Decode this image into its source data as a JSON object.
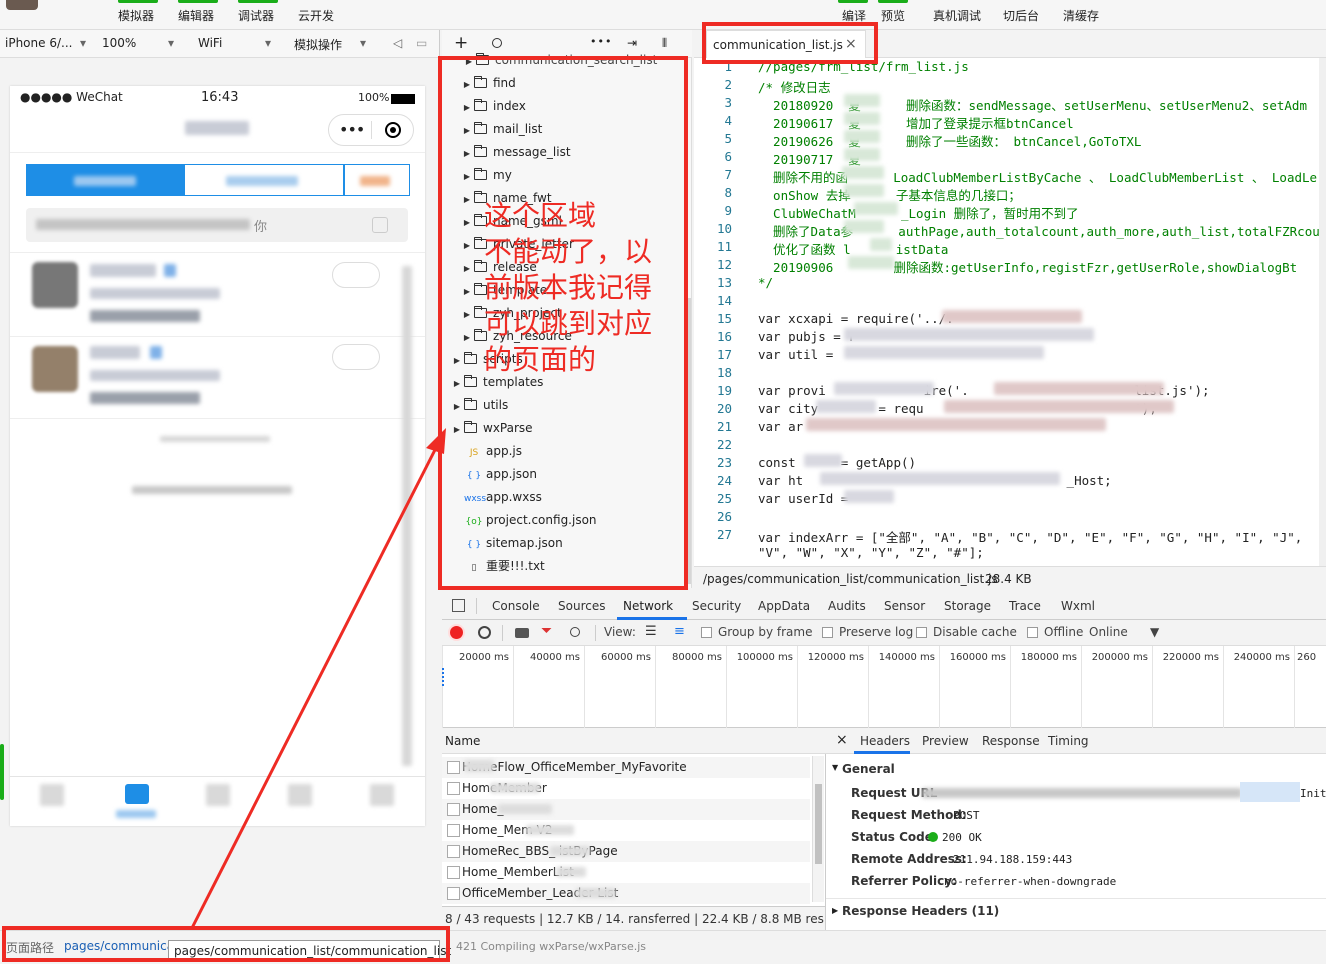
{
  "menu": {
    "simulator": "模拟器",
    "editor": "编辑器",
    "debugger": "调试器",
    "cloud": "云开发",
    "compile": "编译",
    "preview": "预览",
    "remote_debug": "真机调试",
    "background": "切后台",
    "clear_cache": "清缓存"
  },
  "sim_toolbar": {
    "device": "iPhone 6/...",
    "zoom": "100%",
    "network": "WiFi",
    "ops": "模拟操作"
  },
  "phone": {
    "carrier": "●●●●● WeChat",
    "time": "16:43",
    "battery": "100%",
    "search_placeholder_tail": "你"
  },
  "file_tree": {
    "top_partial": "communication_search_list",
    "items": [
      {
        "name": "find",
        "type": "folder",
        "indent": 1
      },
      {
        "name": "index",
        "type": "folder",
        "indent": 1
      },
      {
        "name": "mail_list",
        "type": "folder",
        "indent": 1
      },
      {
        "name": "message_list",
        "type": "folder",
        "indent": 1
      },
      {
        "name": "my",
        "type": "folder",
        "indent": 1
      },
      {
        "name": "name_fwt",
        "type": "folder",
        "indent": 1
      },
      {
        "name": "name_gsml",
        "type": "folder",
        "indent": 1
      },
      {
        "name": "private_letter",
        "type": "folder",
        "indent": 1
      },
      {
        "name": "release",
        "type": "folder",
        "indent": 1
      },
      {
        "name": "template",
        "type": "folder",
        "indent": 1
      },
      {
        "name": "zyh_project",
        "type": "folder",
        "indent": 1
      },
      {
        "name": "zyh_resource",
        "type": "folder",
        "indent": 1
      },
      {
        "name": "scripts",
        "type": "folder",
        "indent": 0
      },
      {
        "name": "templates",
        "type": "folder",
        "indent": 0
      },
      {
        "name": "utils",
        "type": "folder",
        "indent": 0
      },
      {
        "name": "wxParse",
        "type": "folder",
        "indent": 0
      },
      {
        "name": "app.js",
        "type": "js",
        "indent": 0
      },
      {
        "name": "app.json",
        "type": "json",
        "indent": 0
      },
      {
        "name": "app.wxss",
        "type": "wxss",
        "indent": 0
      },
      {
        "name": "project.config.json",
        "type": "config",
        "indent": 0
      },
      {
        "name": "sitemap.json",
        "type": "json",
        "indent": 0
      },
      {
        "name": "重要!!!.txt",
        "type": "txt",
        "indent": 0
      }
    ]
  },
  "editor": {
    "tab_title": "communication_list.js",
    "tab_close": "×",
    "file_path": "/pages/communication_list/communication_list.js",
    "file_size": "28.4 KB",
    "lines": [
      {
        "n": "1",
        "t": "//pages/frm_list/frm_list.js",
        "c": "cmt"
      },
      {
        "n": "2",
        "t": "/* 修改日志",
        "c": "cmt"
      },
      {
        "n": "3",
        "t": "  20180920  夏      删除函数：sendMessage、setUserMenu、setUserMenu2、setAdm",
        "c": "cmt"
      },
      {
        "n": "4",
        "t": "  20190617  夏      增加了登录提示框btnCancel",
        "c": "cmt"
      },
      {
        "n": "5",
        "t": "  20190626  夏      删除了一些函数： btnCancel,GoToTXL",
        "c": "cmt"
      },
      {
        "n": "6",
        "t": "  20190717  夏",
        "c": "cmt"
      },
      {
        "n": "7",
        "t": "  删除不用的函      LoadClubMemberListByCache 、 LoadClubMemberList 、 LoadLe",
        "c": "cmt"
      },
      {
        "n": "8",
        "t": "  onShow 去掉      子基本信息的几接口；",
        "c": "cmt"
      },
      {
        "n": "9",
        "t": "  ClubWeChatM      _Login 删除了，暂时用不到了",
        "c": "cmt"
      },
      {
        "n": "10",
        "t": "  删除了Data参      authPage,auth_totalcount,auth_more,auth_list,totalFZRcoun",
        "c": "cmt"
      },
      {
        "n": "11",
        "t": "  优化了函数 l      istData",
        "c": "cmt"
      },
      {
        "n": "12",
        "t": "  20190906        删除函数:getUserInfo,registFzr,getUserRole,showDialogBt",
        "c": "cmt"
      },
      {
        "n": "13",
        "t": "*/",
        "c": "cmt"
      },
      {
        "n": "14",
        "t": "",
        "c": ""
      },
      {
        "n": "15",
        "t": "var xcxapi = require('../.",
        "c": "code"
      },
      {
        "n": "16",
        "t": "var pubjs = r",
        "c": "code"
      },
      {
        "n": "17",
        "t": "var util = ",
        "c": "code"
      },
      {
        "n": "18",
        "t": "",
        "c": ""
      },
      {
        "n": "19",
        "t": "var provi             ire('.                      list.js');",
        "c": "code"
      },
      {
        "n": "20",
        "t": "var city        = requ                            ');",
        "c": "code"
      },
      {
        "n": "21",
        "t": "var ar             ",
        "c": "code"
      },
      {
        "n": "22",
        "t": "",
        "c": ""
      },
      {
        "n": "23",
        "t": "const      = getApp()",
        "c": "code"
      },
      {
        "n": "24",
        "t": "var ht                                   _Host;",
        "c": "code"
      },
      {
        "n": "25",
        "t": "var userId = ",
        "c": "code"
      },
      {
        "n": "26",
        "t": "",
        "c": ""
      },
      {
        "n": "27",
        "t": "var indexArr = [\"全部\", \"A\", \"B\", \"C\", \"D\", \"E\", \"F\", \"G\", \"H\", \"I\", \"J\", ",
        "c": "code"
      },
      {
        "n": "",
        "t": "\"V\", \"W\", \"X\", \"Y\", \"Z\", \"#\"];",
        "c": "code"
      }
    ]
  },
  "devtools": {
    "tabs": [
      "Console",
      "Sources",
      "Network",
      "Security",
      "AppData",
      "Audits",
      "Sensor",
      "Storage",
      "Trace",
      "Wxml"
    ],
    "active_tab": "Network",
    "view_label": "View:",
    "group_by_frame": "Group by frame",
    "preserve_log": "Preserve log",
    "disable_cache": "Disable cache",
    "offline": "Offline",
    "online": "Online",
    "timeline_ticks": [
      "20000 ms",
      "40000 ms",
      "60000 ms",
      "80000 ms",
      "100000 ms",
      "120000 ms",
      "140000 ms",
      "160000 ms",
      "180000 ms",
      "200000 ms",
      "220000 ms",
      "240000 ms",
      "260"
    ],
    "name_header": "Name",
    "requests": [
      "HomeFlow_OfficeMember_MyFavorite",
      "HomeMember",
      "Home_",
      "Home_Mem          V2",
      "HomeRec_BBS_          istByPage",
      "Home_MemberList",
      "OfficeMember_Leader          List"
    ],
    "summary": "8 / 43 requests  |  12.7 KB / 14.        ransferred  |  22.4 KB / 8.8 MB res...",
    "header_tabs": [
      "Headers",
      "Preview",
      "Response",
      "Timing"
    ],
    "general_label": "General",
    "request_url_label": "Request URL",
    "request_url_tail": "Init",
    "request_method_label": "Request Method:",
    "request_method": "POST",
    "status_code_label": "Status Code:",
    "status_code": "200 OK",
    "remote_address_label": "Remote Address:",
    "remote_address": "211.94.188.159:443",
    "referrer_policy_label": "Referrer Policy:",
    "referrer_policy": "no-referrer-when-downgrade",
    "response_headers_label": "Response Headers (11)"
  },
  "bottom": {
    "page_path_label": "页面路径",
    "page_path_short": "pages/communicat",
    "page_path_full": "pages/communication_list/communication_list",
    "compile_status": "421 Compiling wxParse/wxParse.js"
  },
  "annotation": {
    "lines": [
      "这个区域",
      "不能动了，以",
      "前版本我记得",
      "可以跳到对应",
      "的页面的"
    ]
  }
}
